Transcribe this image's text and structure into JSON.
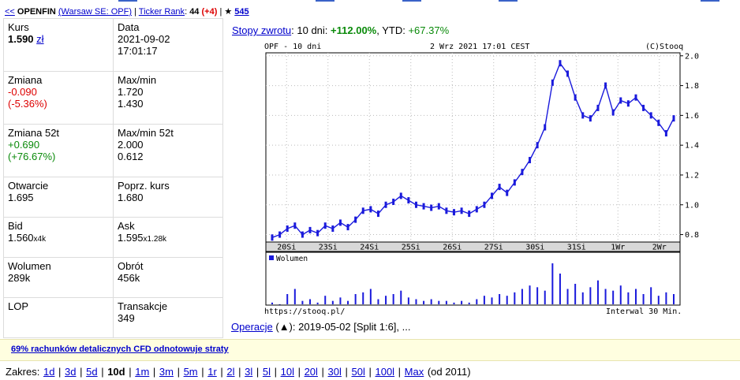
{
  "topbar": {
    "back": "<<",
    "name": "OPENFIN",
    "market": "(Warsaw SE: OPF)",
    "ticker_rank_label": "Ticker Rank",
    "ticker_rank_value": "44",
    "ticker_rank_change": "(+4)",
    "star": "★",
    "star_count": "545"
  },
  "stats": [
    {
      "l_label": "Kurs",
      "l_value": "1.590",
      "l_unit": "zł",
      "r_label": "Data",
      "r_value": "2021-09-02",
      "r_value2": "17:01:17"
    },
    {
      "l_label": "Zmiana",
      "l_value": "-0.090",
      "l_value2": "(-5.36%)",
      "r_label": "Max/min",
      "r_value": "1.720",
      "r_value2": "1.430"
    },
    {
      "l_label": "Zmiana 52t",
      "l_value": "+0.690",
      "l_value2": "(+76.67%)",
      "r_label": "Max/min 52t",
      "r_value": "2.000",
      "r_value2": "0.612"
    },
    {
      "l_label": "Otwarcie",
      "l_value": "1.695",
      "r_label": "Poprz. kurs",
      "r_value": "1.680"
    },
    {
      "l_label": "Bid",
      "l_value": "1.560",
      "l_small": "x4k",
      "r_label": "Ask",
      "r_value": "1.595",
      "r_small": "x1.28k"
    },
    {
      "l_label": "Wolumen",
      "l_value": "289k",
      "r_label": "Obrót",
      "r_value": "456k"
    },
    {
      "l_label": "LOP",
      "r_label": "Transakcje",
      "r_value": "349"
    }
  ],
  "returns": {
    "link": "Stopy zwrotu",
    "period": ": 10 dni: ",
    "value": "+112.00%",
    "ytd_label": ", YTD: ",
    "ytd_value": "+67.37%"
  },
  "chart_data": {
    "type": "line",
    "title": "OPF - 10 dni",
    "subtitle": "2 Wrz 2021 17:01 CEST",
    "credit": "(C)Stooq",
    "footer_left": "https://stooq.pl/",
    "footer_right": "Interwal 30 Min.",
    "volume_legend": "Wolumen",
    "y_ticks": [
      "2.0",
      "1.8",
      "1.6",
      "1.4",
      "1.2",
      "1.0",
      "0.8"
    ],
    "ylim": [
      0.75,
      2.02
    ],
    "x_labels": [
      "20Si",
      "23Si",
      "24Si",
      "25Si",
      "26Si",
      "27Si",
      "30Si",
      "31Si",
      "1Wr",
      "2Wr"
    ],
    "series": [
      {
        "values": [
          0.78,
          0.8,
          0.84,
          0.86,
          0.8,
          0.83,
          0.81,
          0.86,
          0.84,
          0.88,
          0.85,
          0.9,
          0.96,
          0.97,
          0.94,
          1.0,
          1.02,
          1.06,
          1.03,
          1.0,
          0.99,
          0.98,
          0.99,
          0.96,
          0.95,
          0.96,
          0.94,
          0.97,
          1.0,
          1.06,
          1.12,
          1.08,
          1.15,
          1.22,
          1.3,
          1.4,
          1.52,
          1.82,
          1.95,
          1.88,
          1.72,
          1.6,
          1.58,
          1.65,
          1.8,
          1.62,
          1.7,
          1.68,
          1.72,
          1.65,
          1.6,
          1.55,
          1.48,
          1.58
        ]
      }
    ],
    "volume": [
      1,
      0,
      6,
      9,
      2,
      3,
      1,
      5,
      2,
      4,
      2,
      6,
      7,
      9,
      3,
      5,
      6,
      8,
      4,
      3,
      2,
      3,
      2,
      2,
      1,
      2,
      1,
      3,
      5,
      4,
      6,
      5,
      7,
      9,
      11,
      10,
      8,
      24,
      18,
      9,
      12,
      7,
      10,
      14,
      9,
      8,
      11,
      7,
      9,
      6,
      10,
      5,
      7,
      6
    ]
  },
  "operations": {
    "link": "Operacje",
    "text": " (▲): 2019-05-02 [Split 1:6], ..."
  },
  "cfd_warning": "69% rachunków detalicznych CFD odnotowuje straty",
  "zakres": {
    "label": "Zakres: ",
    "items": [
      "1d",
      "3d",
      "5d",
      "10d",
      "1m",
      "3m",
      "5m",
      "1r",
      "2l",
      "3l",
      "5l",
      "10l",
      "20l",
      "30l",
      "50l",
      "100l",
      "Max"
    ],
    "selected": "10d",
    "suffix": " (od 2011)"
  }
}
